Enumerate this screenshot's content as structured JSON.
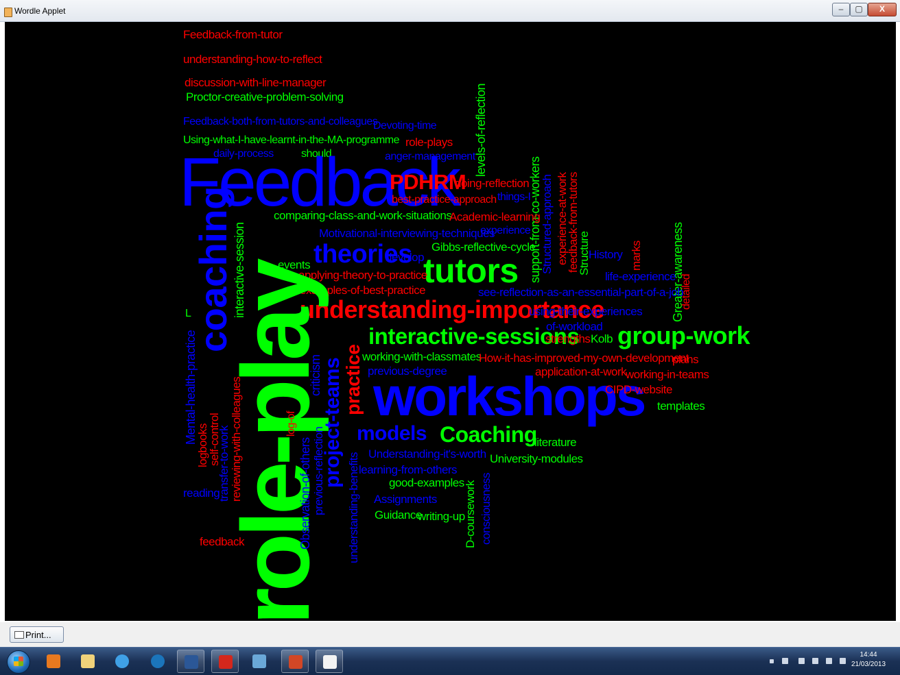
{
  "window": {
    "title": "Wordle Applet",
    "controls": {
      "minimize": "–",
      "maximize": "▢",
      "close": "X"
    }
  },
  "colors": {
    "red": "#ff0000",
    "green": "#00ff00",
    "blue": "#0000ff",
    "background": "#000000"
  },
  "wordcloud": {
    "words": [
      {
        "text": "Feedback-from-tutor",
        "color": "red"
      },
      {
        "text": "understanding-how-to-reflect",
        "color": "red"
      },
      {
        "text": "discussion-with-line-manager",
        "color": "red"
      },
      {
        "text": "Proctor-creative-problem-solving",
        "color": "green"
      },
      {
        "text": "Feedback-both-from-tutors-and-colleagues",
        "color": "blue"
      },
      {
        "text": "Devoting-time",
        "color": "blue"
      },
      {
        "text": "Using-what-I-have-learnt-in-the-MA-programme",
        "color": "green"
      },
      {
        "text": "role-plays",
        "color": "red"
      },
      {
        "text": "daily-process",
        "color": "blue"
      },
      {
        "text": "should",
        "color": "green"
      },
      {
        "text": "anger-management",
        "color": "blue"
      },
      {
        "text": "levels-of-reflection",
        "color": "green"
      },
      {
        "text": "Feedback",
        "color": "blue"
      },
      {
        "text": "PDHRM",
        "color": "red"
      },
      {
        "text": "doing-reflection",
        "color": "red"
      },
      {
        "text": "best-practice-approach",
        "color": "red"
      },
      {
        "text": "things-I",
        "color": "blue"
      },
      {
        "text": "support-from-co-workers",
        "color": "green"
      },
      {
        "text": "Structured-approach",
        "color": "blue"
      },
      {
        "text": "experience-at-work",
        "color": "red"
      },
      {
        "text": "feedback-from-tutors",
        "color": "red"
      },
      {
        "text": "comparing-class-and-work-situations",
        "color": "green"
      },
      {
        "text": "Academic-learning",
        "color": "red"
      },
      {
        "text": "Motivational-interviewing-techniques",
        "color": "blue"
      },
      {
        "text": "experience",
        "color": "blue"
      },
      {
        "text": "Structure",
        "color": "green"
      },
      {
        "text": "Greater-awareness",
        "color": "green"
      },
      {
        "text": "Gibbs-reflective-cycle",
        "color": "green"
      },
      {
        "text": "marks",
        "color": "red"
      },
      {
        "text": "theories",
        "color": "blue"
      },
      {
        "text": "develop",
        "color": "blue"
      },
      {
        "text": "History",
        "color": "blue"
      },
      {
        "text": "events",
        "color": "green"
      },
      {
        "text": "tutors",
        "color": "green"
      },
      {
        "text": "life-experience",
        "color": "blue"
      },
      {
        "text": "applying-theory-to-practice",
        "color": "red"
      },
      {
        "text": "examples-of-best-practice",
        "color": "red"
      },
      {
        "text": "see-reflection-as-an-essential-part-of-a-job",
        "color": "blue"
      },
      {
        "text": "detailed",
        "color": "red"
      },
      {
        "text": "interactive-session",
        "color": "green"
      },
      {
        "text": "coaching",
        "color": "blue"
      },
      {
        "text": "understanding-importance",
        "color": "red"
      },
      {
        "text": "using-their-experiences",
        "color": "blue"
      },
      {
        "text": "of-workload",
        "color": "blue"
      },
      {
        "text": "L",
        "color": "green"
      },
      {
        "text": "interactive-sessions",
        "color": "green"
      },
      {
        "text": "strengths",
        "color": "red"
      },
      {
        "text": "Kolb",
        "color": "green"
      },
      {
        "text": "group-work",
        "color": "green"
      },
      {
        "text": "Mental-health-practice",
        "color": "blue"
      },
      {
        "text": "role-play",
        "color": "green"
      },
      {
        "text": "criticism",
        "color": "blue"
      },
      {
        "text": "project-teams",
        "color": "blue"
      },
      {
        "text": "practice",
        "color": "red"
      },
      {
        "text": "working-with-classmates",
        "color": "green"
      },
      {
        "text": "How-it-has-improved-my-own-development",
        "color": "red"
      },
      {
        "text": "plans",
        "color": "red"
      },
      {
        "text": "previous-degree",
        "color": "blue"
      },
      {
        "text": "application-at-work",
        "color": "red"
      },
      {
        "text": "working-in-teams",
        "color": "red"
      },
      {
        "text": "workshops",
        "color": "blue"
      },
      {
        "text": "CIPD-website",
        "color": "red"
      },
      {
        "text": "templates",
        "color": "green"
      },
      {
        "text": "log-of",
        "color": "red"
      },
      {
        "text": "logbooks",
        "color": "red"
      },
      {
        "text": "self-control",
        "color": "red"
      },
      {
        "text": "transfer-to-work",
        "color": "blue"
      },
      {
        "text": "reviewing-with-colleagues",
        "color": "red"
      },
      {
        "text": "Observation-of-others",
        "color": "blue"
      },
      {
        "text": "previous-reflection",
        "color": "blue"
      },
      {
        "text": "understanding-benefits",
        "color": "blue"
      },
      {
        "text": "models",
        "color": "blue"
      },
      {
        "text": "Coaching",
        "color": "green"
      },
      {
        "text": "literature",
        "color": "green"
      },
      {
        "text": "Understanding-it's-worth",
        "color": "blue"
      },
      {
        "text": "University-modules",
        "color": "green"
      },
      {
        "text": "learning-from-others",
        "color": "blue"
      },
      {
        "text": "D-coursework",
        "color": "green"
      },
      {
        "text": "consciousness",
        "color": "blue"
      },
      {
        "text": "good-examples",
        "color": "green"
      },
      {
        "text": "reading",
        "color": "blue"
      },
      {
        "text": "Assignments",
        "color": "blue"
      },
      {
        "text": "Guidance",
        "color": "green"
      },
      {
        "text": "writing-up",
        "color": "green"
      },
      {
        "text": "feedback",
        "color": "red"
      }
    ]
  },
  "footer": {
    "print_label": "Print..."
  },
  "taskbar": {
    "apps": [
      {
        "name": "media-player",
        "icon": "media-player-icon"
      },
      {
        "name": "explorer",
        "icon": "folder-icon"
      },
      {
        "name": "internet-explorer",
        "icon": "ie-icon"
      },
      {
        "name": "dell",
        "icon": "dell-icon"
      },
      {
        "name": "word",
        "icon": "word-icon"
      },
      {
        "name": "acrobat",
        "icon": "pdf-icon"
      },
      {
        "name": "paint",
        "icon": "paint-icon"
      },
      {
        "name": "powerpoint",
        "icon": "powerpoint-icon"
      },
      {
        "name": "java",
        "icon": "java-icon"
      }
    ],
    "clock_time": "14:44",
    "clock_date": "21/03/2013"
  }
}
